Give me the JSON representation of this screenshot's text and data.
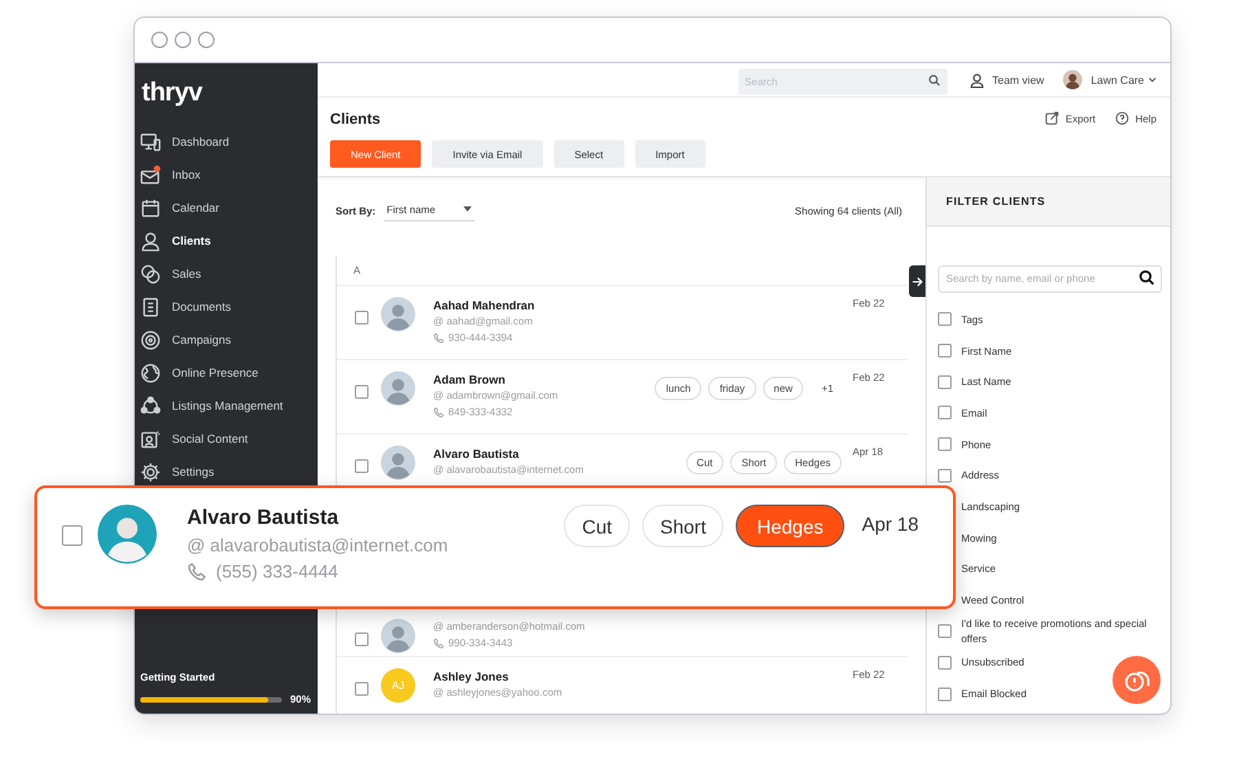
{
  "logo": "thryv",
  "sidebar": {
    "items": [
      {
        "label": "Dashboard",
        "selected": false
      },
      {
        "label": "Inbox",
        "selected": false
      },
      {
        "label": "Calendar",
        "selected": false
      },
      {
        "label": "Clients",
        "selected": true
      },
      {
        "label": "Sales",
        "selected": false
      },
      {
        "label": "Documents",
        "selected": false
      },
      {
        "label": "Campaigns",
        "selected": false
      },
      {
        "label": "Online Presence",
        "selected": false
      },
      {
        "label": "Listings Management",
        "selected": false
      },
      {
        "label": "Social Content",
        "selected": false
      },
      {
        "label": "Settings",
        "selected": false
      }
    ]
  },
  "getting_started": {
    "label": "Getting Started",
    "level": 0.9,
    "reading": "90%"
  },
  "topbar": {
    "search": {
      "placeholder": "Search"
    },
    "team_view": "Team view",
    "account": "Lawn Care"
  },
  "page": {
    "title": "Clients",
    "buttons": [
      {
        "label": "New Client",
        "kind": "primary"
      },
      {
        "label": "Invite via Email",
        "kind": "secondary"
      },
      {
        "label": "Select",
        "kind": "secondary"
      },
      {
        "label": "Import",
        "kind": "secondary"
      }
    ],
    "links": [
      "Export",
      "Help"
    ]
  },
  "list": {
    "sort_label": "Sort By:",
    "sort_value": "First name",
    "count": "Showing 64 clients (All)",
    "section": "A",
    "clients": [
      {
        "name": "Aahad Mahendran",
        "email": "@ aahad@gmail.com",
        "phone": "930-444-3394",
        "date": "Feb 22",
        "checked": false,
        "avatar": {
          "kind": "photo"
        }
      },
      {
        "name": "Adam Brown",
        "email": "@ adambrown@gmail.com",
        "phone": "849-333-4332",
        "date": "Feb 22",
        "checked": false,
        "avatar": {
          "kind": "photo"
        },
        "tags": [
          {
            "label": "lunch",
            "selected": false
          },
          {
            "label": "friday",
            "selected": false
          },
          {
            "label": "new",
            "selected": false
          }
        ],
        "more": "+1"
      },
      {
        "name": "Alvaro Bautista",
        "email": "@ alavarobautista@internet.com",
        "date": "Apr 18",
        "checked": false,
        "avatar": {
          "kind": "photo"
        },
        "tags": [
          {
            "label": "Cut",
            "selected": false
          },
          {
            "label": "Short",
            "selected": false
          },
          {
            "label": "Hedges",
            "selected": false
          }
        ]
      },
      {
        "email": "@ amberanderson@hotmail.com",
        "phone": "990-334-3443",
        "checked": false,
        "avatar": {
          "kind": "photo"
        }
      },
      {
        "name": "Ashley Jones",
        "email": "@ ashleyjones@yahoo.com",
        "date": "Feb 22",
        "checked": false,
        "avatar": {
          "kind": "initials",
          "text": "AJ"
        }
      }
    ]
  },
  "filter": {
    "title": "FILTER CLIENTS",
    "search": {
      "placeholder": "Search by name, email or phone"
    },
    "options": [
      {
        "label": "Tags",
        "checked": false
      },
      {
        "label": "First Name",
        "checked": false
      },
      {
        "label": "Last Name",
        "checked": false
      },
      {
        "label": "Email",
        "checked": false
      },
      {
        "label": "Phone",
        "checked": false
      },
      {
        "label": "Address",
        "checked": false
      },
      {
        "label": "Landscaping"
      },
      {
        "label": "Mowing"
      },
      {
        "label": "Service"
      },
      {
        "label": "Weed Control"
      },
      {
        "label": "I'd like to receive promotions and special offers",
        "checked": false
      },
      {
        "label": "Unsubscribed",
        "checked": false
      },
      {
        "label": "Email Blocked",
        "checked": false
      }
    ]
  },
  "callout": {
    "checked": false,
    "name": "Alvaro Bautista",
    "email": "@ alavarobautista@internet.com",
    "phone": "(555) 333-4444",
    "date": "Apr 18",
    "tags": [
      {
        "label": "Cut",
        "selected": false
      },
      {
        "label": "Short",
        "selected": false
      },
      {
        "label": "Hedges",
        "selected": true
      }
    ]
  }
}
